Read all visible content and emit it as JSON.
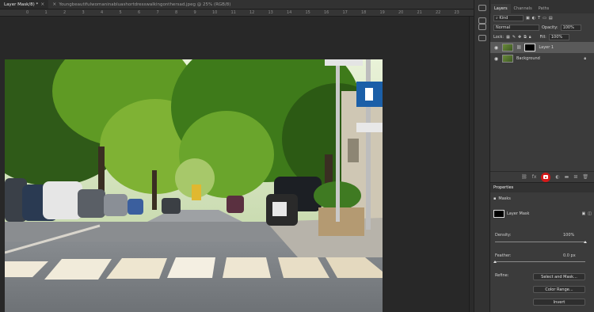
{
  "tabs": [
    {
      "label": "Layer Mask/8) *",
      "close": "×"
    },
    {
      "label": "Youngbeautifulwomaninabluashortdresswalkingonthersad.jpeg @ 25% (RGB/8)",
      "close": "×"
    }
  ],
  "ruler": [
    "0",
    "1",
    "2",
    "3",
    "4",
    "5",
    "6",
    "7",
    "8",
    "9",
    "10",
    "11",
    "12",
    "13",
    "14",
    "15",
    "16",
    "17",
    "18",
    "19",
    "20",
    "21",
    "22",
    "23"
  ],
  "layers_panel": {
    "tabs": [
      "Layers",
      "Channels",
      "Paths"
    ],
    "kind": "Kind",
    "blend_mode": "Normal",
    "opacity_label": "Opacity:",
    "opacity_value": "100%",
    "lock_label": "Lock:",
    "fill_label": "Fill:",
    "fill_value": "100%",
    "layers": [
      {
        "name": "Layer 1",
        "selected": true
      },
      {
        "name": "Background",
        "selected": false
      }
    ]
  },
  "properties": {
    "title": "Properties",
    "masks_label": "Masks",
    "mask_name": "Layer Mask",
    "density_label": "Density:",
    "density_value": "100%",
    "density_level": 1.0,
    "feather_label": "Feather:",
    "feather_value": "0.0 px",
    "feather_level": 0.0,
    "refine_label": "Refine:",
    "select_and_mask": "Select and Mask...",
    "color_range": "Color Range...",
    "invert": "Invert"
  },
  "colors": {
    "highlight": "#d41818",
    "panel_bg": "#3b3b3b",
    "canvas_bg": "#282828"
  }
}
